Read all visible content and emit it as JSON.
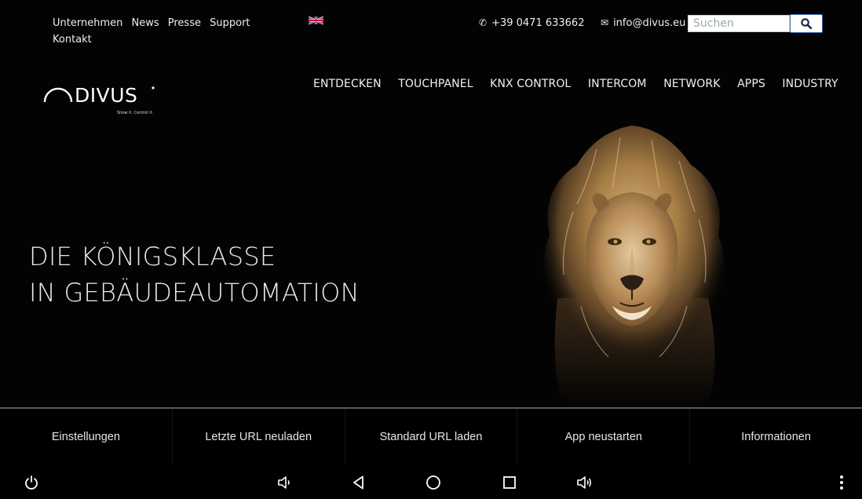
{
  "header": {
    "util_links": [
      "Unternehmen",
      "News",
      "Presse",
      "Support",
      "Kontakt"
    ],
    "phone": "+39 0471 633662",
    "email": "info@divus.eu",
    "search": {
      "placeholder": "Suchen",
      "value": ""
    },
    "language_flag": "uk-flag-icon",
    "logo": {
      "brand": "DIVUS",
      "tagline": "Show it. Control it."
    }
  },
  "mainnav": [
    "ENTDECKEN",
    "TOUCHPANEL",
    "KNX CONTROL",
    "INTERCOM",
    "NETWORK",
    "APPS",
    "INDUSTRY"
  ],
  "hero": {
    "line1": "DIE KÖNIGSKLASSE",
    "line2": "IN GEBÄUDEAUTOMATION",
    "image": "lion-portrait"
  },
  "bottom_menu": [
    "Einstellungen",
    "Letzte URL neuladen",
    "Standard URL laden",
    "App neustarten",
    "Informationen"
  ],
  "system_nav": {
    "icons": [
      "power-icon",
      "volume-down-icon",
      "back-icon",
      "home-icon",
      "recents-icon",
      "volume-up-icon",
      "overflow-menu-icon"
    ]
  },
  "colors": {
    "background": "#000000",
    "divider": "#5b5b5b",
    "search_border": "#3a6fb0",
    "text": "#e6e6e6"
  }
}
